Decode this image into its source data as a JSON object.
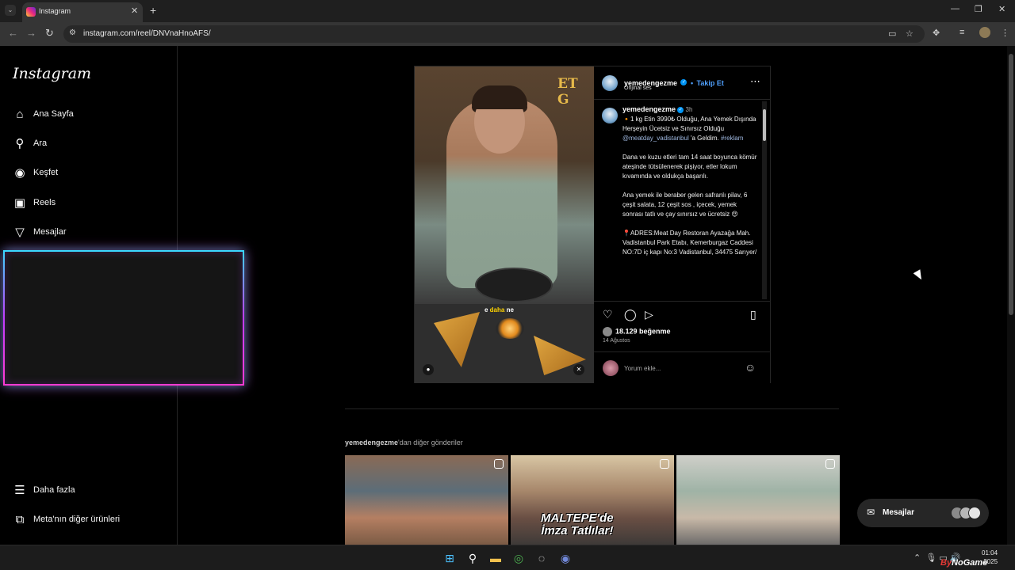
{
  "browser": {
    "tab_title": "Instagram",
    "url": "instagram.com/reel/DNVnaHnoAFS/"
  },
  "sidebar": {
    "logo": "Instagram",
    "items": [
      {
        "label": "Ana Sayfa",
        "icon": "home-icon"
      },
      {
        "label": "Ara",
        "icon": "search-icon"
      },
      {
        "label": "Keşfet",
        "icon": "compass-icon"
      },
      {
        "label": "Reels",
        "icon": "reels-icon"
      },
      {
        "label": "Mesajlar",
        "icon": "send-icon"
      }
    ],
    "bottom_items": [
      {
        "label": "Daha fazla",
        "icon": "menu-icon"
      },
      {
        "label": "Meta'nın diğer ürünleri",
        "icon": "grid-icon"
      }
    ]
  },
  "post": {
    "username": "yemedengezme",
    "follow_label": "Takip Et",
    "audio": "Orijinal ses",
    "time_ago": "3h",
    "video_sign": "ET G",
    "video_caption_pre": "e ",
    "video_caption_hl": "daha",
    "video_caption_post": " ne",
    "caption_p1_a": "🔸1 kg Etin 3990₺ Olduğu, Ana Yemek Dışında Herşeyin Ücetsiz ve Sınırsız Olduğu ",
    "caption_mention": "@meatday_vadistanbul",
    "caption_p1_b": " 'a Geldim. ",
    "caption_hashtag": "#reklam",
    "caption_p2": "Dana ve kuzu etleri tam 14 saat boyunca kömür ateşinde tütsülenerek pişiyor, etler lokum kıvamında ve oldukça başarılı.",
    "caption_p3": "Ana yemek ile beraber gelen safranlı pilav, 6 çeşit salata, 12 çeşit sos , içecek, yemek sonrası tatlı ve çay sınırsız ve ücretsiz 😍",
    "caption_p4": "📍ADRES:Meat Day Restoran Ayazağa Mah. Vadistanbul Park Etabı, Kemerburgaz Caddesi NO:7D iç kapı No:3 Vadistanbul, 34475 Sarıyer/",
    "likes": "18.129 beğenme",
    "date": "14 Ağustos",
    "comment_placeholder": "Yorum ekle..."
  },
  "more_posts": {
    "username": "yemedengezme",
    "suffix": "'dan diğer gönderiler",
    "thumb2_overlay_line1": "MALTEPE'de",
    "thumb2_overlay_line2": "İmza Tatlılar!"
  },
  "messages_bar": {
    "label": "Mesajlar"
  },
  "taskbar": {
    "time": "01:04",
    "date": "2025",
    "watermark_a": "By",
    "watermark_b": "NoGame"
  }
}
